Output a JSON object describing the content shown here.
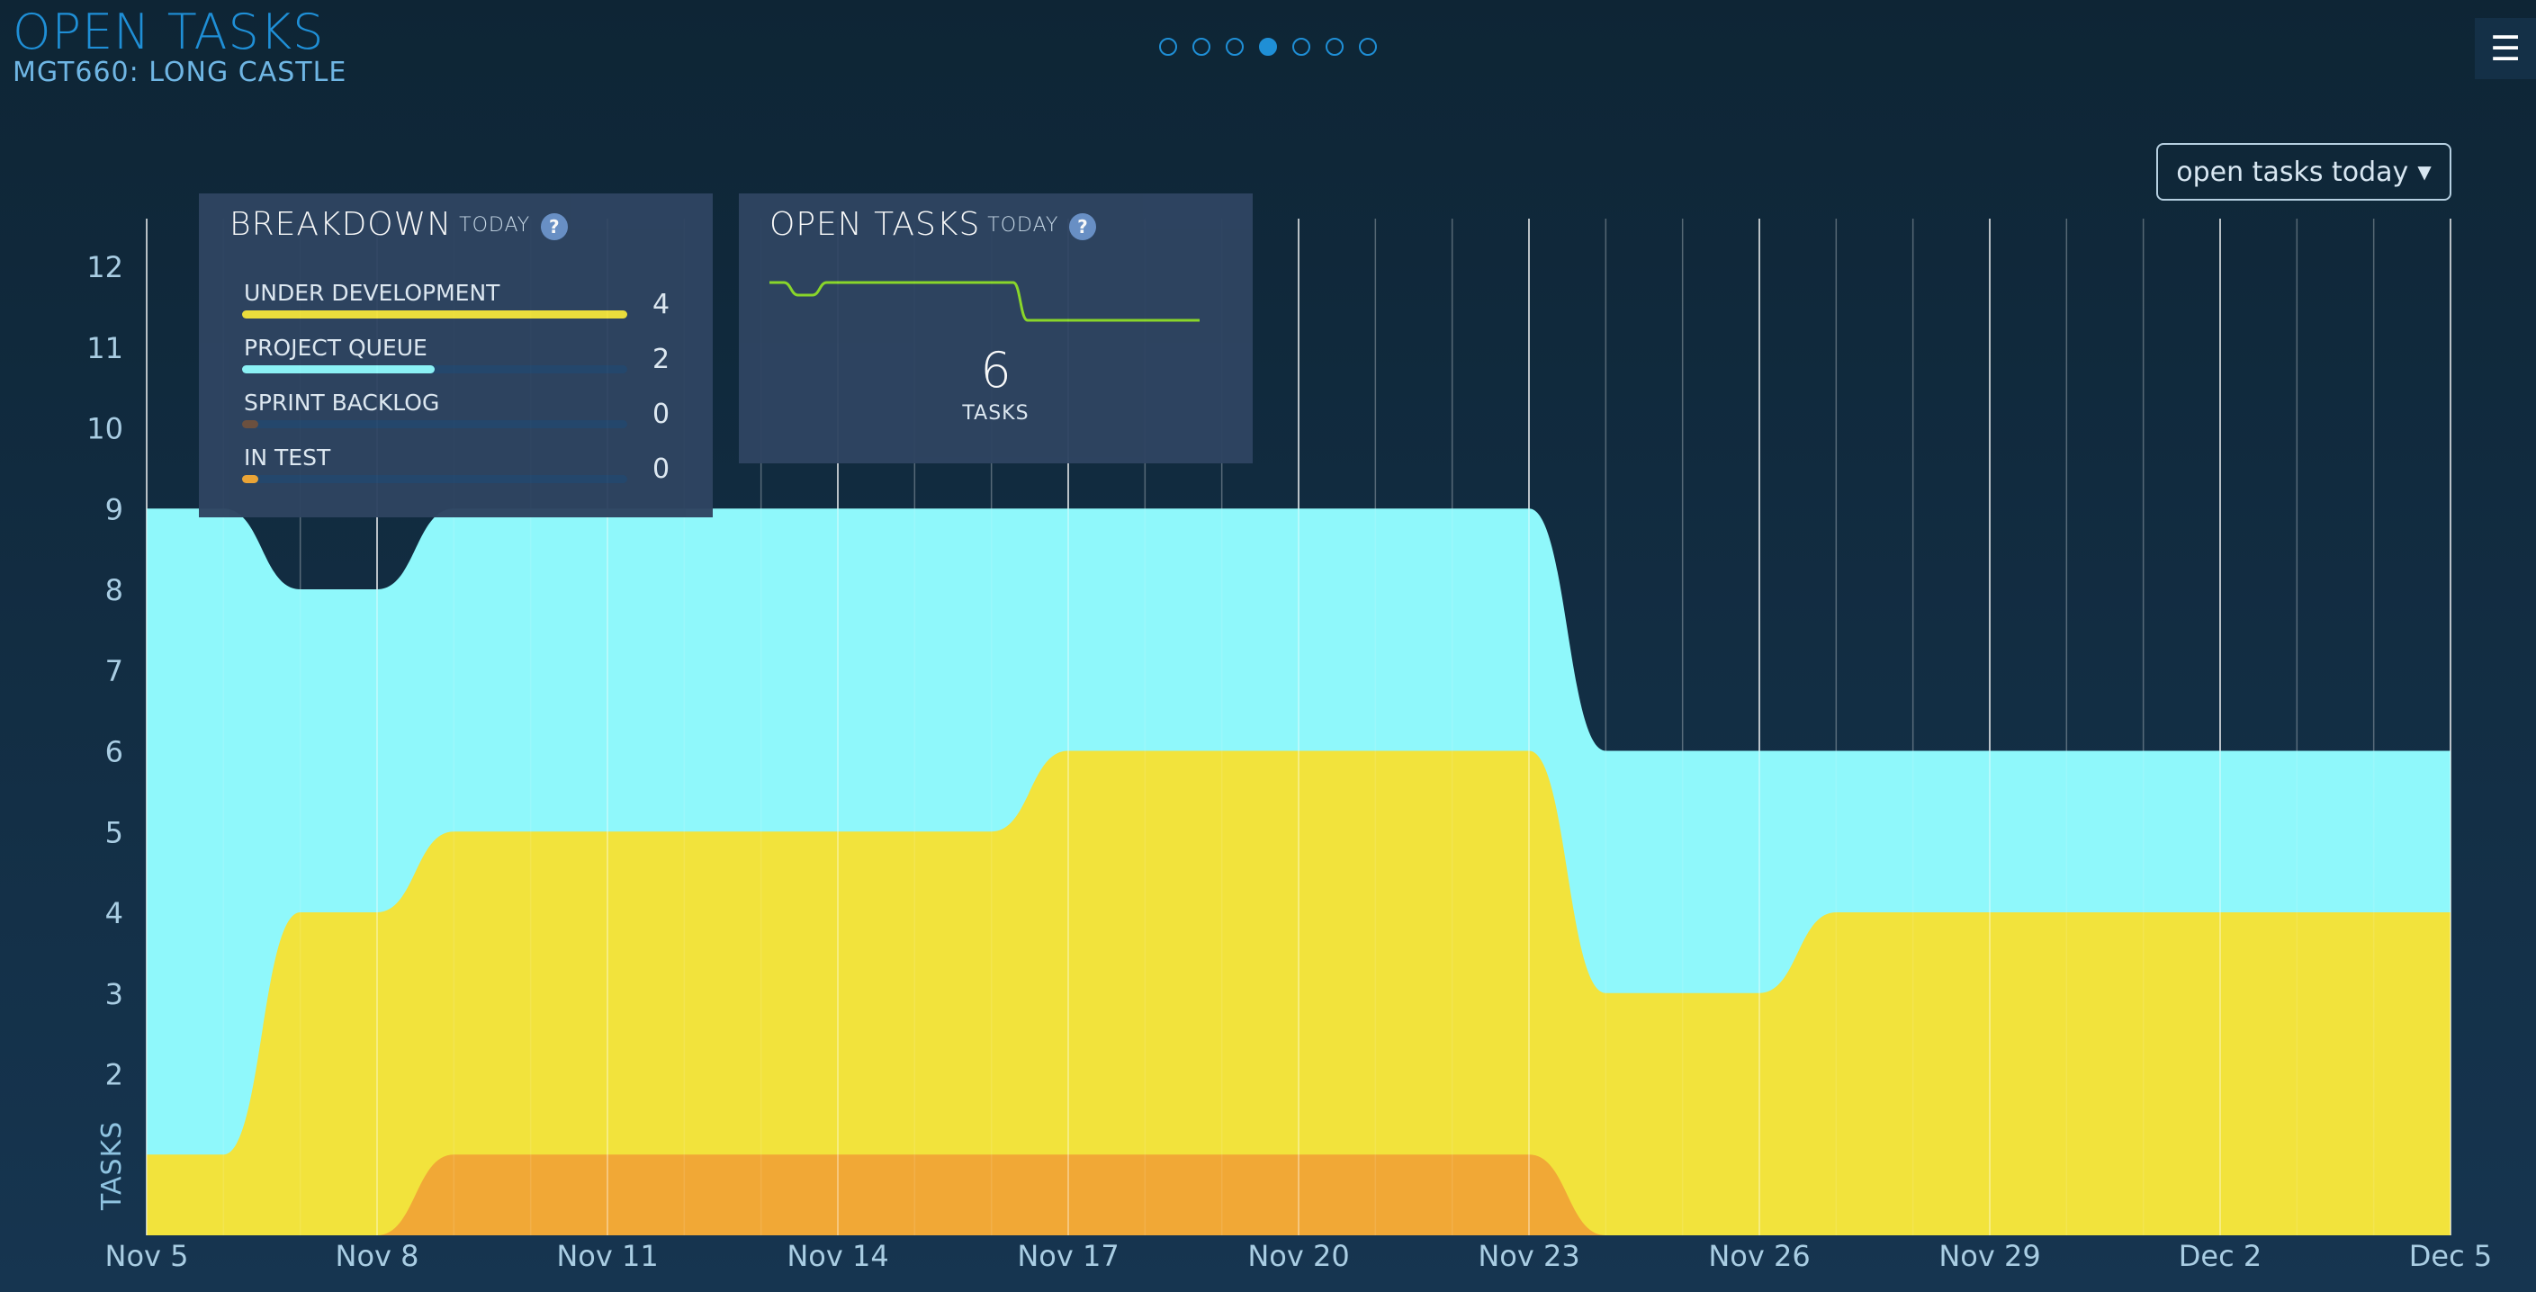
{
  "header": {
    "title": "OPEN TASKS",
    "subtitle": "MGT660: LONG CASTLE",
    "pager_count": 7,
    "pager_active": 3
  },
  "metric_select": {
    "label": "open tasks today"
  },
  "breakdown": {
    "title": "BREAKDOWN",
    "qualifier": "TODAY",
    "scale_max": 4,
    "rows": [
      {
        "label": "UNDER DEVELOPMENT",
        "count": 4,
        "value": 4,
        "color": "#f2e33c"
      },
      {
        "label": "PROJECT QUEUE",
        "count": 2,
        "value": 2,
        "color": "#8ff8fb"
      },
      {
        "label": "SPRINT BACKLOG",
        "count": 0,
        "value": 0,
        "color": "#6e5240"
      },
      {
        "label": "IN TEST",
        "count": 0,
        "value": 0,
        "color": "#f1a836"
      }
    ]
  },
  "open_tasks": {
    "title": "OPEN TASKS",
    "qualifier": "TODAY",
    "value": "6",
    "caption": "TASKS",
    "sparkline_values": [
      9,
      9,
      8,
      8,
      9,
      9,
      9,
      9,
      9,
      9,
      9,
      9,
      9,
      9,
      9,
      9,
      9,
      9,
      6,
      6,
      6,
      6,
      6,
      6,
      6,
      6,
      6,
      6,
      6,
      6,
      6
    ],
    "sparkline_color": "#8ddc2a"
  },
  "chart_data": {
    "type": "area",
    "stacked": true,
    "ylabel": "TASKS",
    "xlabel": "",
    "ylim": [
      0,
      12
    ],
    "yticks": [
      2,
      3,
      4,
      5,
      6,
      7,
      8,
      9,
      10,
      11,
      12
    ],
    "x_tick_labels": [
      "Nov 5",
      "Nov 8",
      "Nov 11",
      "Nov 14",
      "Nov 17",
      "Nov 20",
      "Nov 23",
      "Nov 26",
      "Nov 29",
      "Dec 2",
      "Dec 5"
    ],
    "x": [
      "Nov 5",
      "Nov 6",
      "Nov 7",
      "Nov 8",
      "Nov 9",
      "Nov 10",
      "Nov 11",
      "Nov 12",
      "Nov 13",
      "Nov 14",
      "Nov 15",
      "Nov 16",
      "Nov 17",
      "Nov 18",
      "Nov 19",
      "Nov 20",
      "Nov 21",
      "Nov 22",
      "Nov 23",
      "Nov 24",
      "Nov 25",
      "Nov 26",
      "Nov 27",
      "Nov 28",
      "Nov 29",
      "Nov 30",
      "Dec 1",
      "Dec 2",
      "Dec 3",
      "Dec 4",
      "Dec 5"
    ],
    "grid": true,
    "series": [
      {
        "name": "IN TEST",
        "color": "#f1a836",
        "values": [
          0,
          0,
          0,
          0,
          1,
          1,
          1,
          1,
          1,
          1,
          1,
          1,
          1,
          1,
          1,
          1,
          1,
          1,
          1,
          0,
          0,
          0,
          0,
          0,
          0,
          0,
          0,
          0,
          0,
          0,
          0
        ]
      },
      {
        "name": "UNDER DEVELOPMENT",
        "color": "#f2e33c",
        "values": [
          1,
          1,
          4,
          4,
          4,
          4,
          4,
          4,
          4,
          4,
          4,
          4,
          5,
          5,
          5,
          5,
          5,
          5,
          5,
          3,
          3,
          3,
          4,
          4,
          4,
          4,
          4,
          4,
          4,
          4,
          4
        ]
      },
      {
        "name": "PROJECT QUEUE",
        "color": "#8ff8fb",
        "values": [
          8,
          8,
          4,
          4,
          4,
          4,
          4,
          4,
          4,
          4,
          4,
          4,
          3,
          3,
          3,
          3,
          3,
          3,
          3,
          3,
          3,
          3,
          2,
          2,
          2,
          2,
          2,
          2,
          2,
          2,
          2
        ]
      }
    ]
  }
}
